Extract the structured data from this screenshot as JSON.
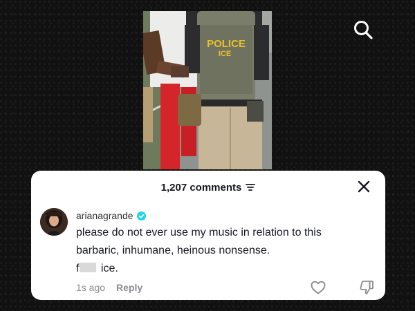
{
  "comments_header": {
    "count_label": "1,207 comments",
    "filter_icon": "filter-lines-icon",
    "close_icon": "close-icon"
  },
  "video": {
    "vest_text_top": "POLICE",
    "vest_text_bottom": "ICE"
  },
  "top_bar": {
    "search_icon": "search-icon"
  },
  "comment": {
    "username": "arianagrande",
    "verified_icon": "verified-check-icon",
    "line1": "please do not ever use my music in relation to this",
    "line2": "barbaric, inhumane, heinous nonsense.",
    "line3_prefix": "f",
    "line3_suffix": "ice.",
    "time": "1s ago",
    "reply_label": "Reply",
    "like_icon": "heart-outline-icon",
    "dislike_icon": "thumbs-down-icon"
  },
  "colors": {
    "verified": "#20d5ec",
    "text": "#161823",
    "muted": "#8a8b91",
    "vest_text": "#e8c12a"
  }
}
